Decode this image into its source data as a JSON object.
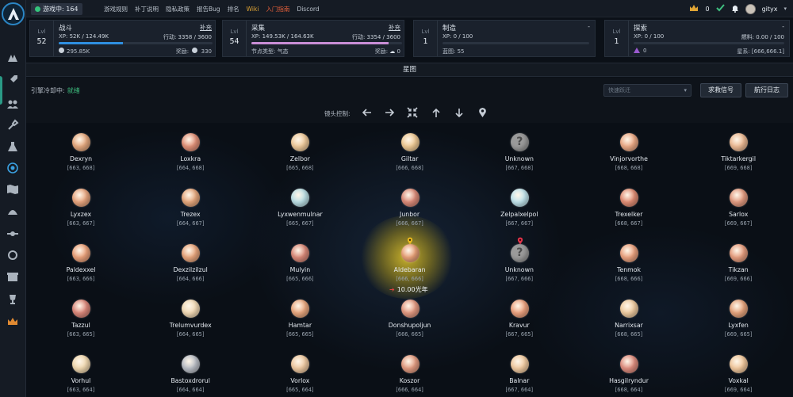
{
  "topbar": {
    "online_label": "游戏中: 164",
    "links": [
      "游戏规则",
      "补丁说明",
      "隐私政策",
      "报告Bug",
      "排名",
      "Wiki",
      "入门指南",
      "Discord"
    ],
    "crown_count": "0",
    "username": "gityx"
  },
  "stats": {
    "combat": {
      "lvl_label": "Lvl",
      "level": "52",
      "name": "战斗",
      "link": "补充",
      "xp": "XP: 52K / 124.49K",
      "action": "行动: 3358 / 3600",
      "progress": 0.42,
      "resource": "295.85K",
      "reward_label": "奖励:",
      "reward_value": "330",
      "bar_color": "#2f8fe0"
    },
    "gathering": {
      "lvl_label": "Lvl",
      "level": "54",
      "name": "采集",
      "link": "补充",
      "xp": "XP: 149.53K / 164.63K",
      "action": "行动: 3354 / 3600",
      "progress": 0.91,
      "node_type": "节点类型: 气态",
      "reward_label": "奖励:",
      "reward_value": "0",
      "bar_color": "#c98ed6"
    },
    "crafting": {
      "lvl_label": "Lvl",
      "level": "1",
      "name": "制造",
      "link": "-",
      "xp": "XP: 0 / 100",
      "blueprint": "蓝图: 55",
      "progress": 0
    },
    "exploring": {
      "lvl_label": "Lvl",
      "level": "1",
      "name": "探索",
      "link": "-",
      "xp": "XP: 0 / 100",
      "fuel": "燃料: 0.00 / 100",
      "crystal": "0",
      "star": "星系: [666,666.1]",
      "progress": 0
    }
  },
  "map": {
    "title": "星图",
    "cooldown_label": "引擎冷却中:",
    "cooldown_status": "就绪",
    "jump_placeholder": "快速跃迁",
    "sos_button": "求救信号",
    "log_button": "航行日志",
    "camera_label": "镜头控制:",
    "distance": "10.00光年"
  },
  "stars": [
    {
      "name": "Dexryn",
      "coord": "[663, 668]",
      "color": "#e2a77e"
    },
    {
      "name": "Loxkra",
      "coord": "[664, 668]",
      "color": "#de9078"
    },
    {
      "name": "Zelbor",
      "coord": "[665, 668]",
      "color": "#ecc89a"
    },
    {
      "name": "Giltar",
      "coord": "[666, 668]",
      "color": "#ecc894"
    },
    {
      "name": "Unknown",
      "coord": "[667, 668]",
      "color": "unknown"
    },
    {
      "name": "Vinjorvorthe",
      "coord": "[668, 668]",
      "color": "#e9a885"
    },
    {
      "name": "Tiktarkergil",
      "coord": "[669, 668]",
      "color": "#eab893"
    },
    {
      "name": "Lyxzex",
      "coord": "[663, 667]",
      "color": "#e6a47e"
    },
    {
      "name": "Trezex",
      "coord": "[664, 667]",
      "color": "#e3a67c"
    },
    {
      "name": "Lyxwenmulnar",
      "coord": "[665, 667]",
      "color": "#b9dde3"
    },
    {
      "name": "Junbor",
      "coord": "[666, 667]",
      "color": "#d98a78"
    },
    {
      "name": "Zelpalxelpol",
      "coord": "[667, 667]",
      "color": "#bfe2ea"
    },
    {
      "name": "Trexelker",
      "coord": "[668, 667]",
      "color": "#de8c74"
    },
    {
      "name": "Sarlox",
      "coord": "[669, 667]",
      "color": "#e09a80"
    },
    {
      "name": "Paldexxel",
      "coord": "[663, 666]",
      "color": "#e8a07a"
    },
    {
      "name": "Dexzilzilzul",
      "coord": "[664, 666]",
      "color": "#e6a47c"
    },
    {
      "name": "Mulyin",
      "coord": "[665, 666]",
      "color": "#d78878"
    },
    {
      "name": "Aldebaran",
      "coord": "[666, 666]",
      "color": "#e59e76"
    },
    {
      "name": "Unknown",
      "coord": "[667, 666]",
      "color": "unknown"
    },
    {
      "name": "Tenmok",
      "coord": "[668, 666]",
      "color": "#e8a07e"
    },
    {
      "name": "Tikzan",
      "coord": "[669, 666]",
      "color": "#e49c7e"
    },
    {
      "name": "Tazzul",
      "coord": "[663, 665]",
      "color": "#d9877a"
    },
    {
      "name": "Trelumvurdex",
      "coord": "[664, 665]",
      "color": "#f0d8b4"
    },
    {
      "name": "Hamtar",
      "coord": "[665, 665]",
      "color": "#e6a67e"
    },
    {
      "name": "Donshupoljun",
      "coord": "[666, 665]",
      "color": "#e09880"
    },
    {
      "name": "Kravur",
      "coord": "[667, 665]",
      "color": "#e9a07e"
    },
    {
      "name": "Narrixsar",
      "coord": "[668, 665]",
      "color": "#ecc99f"
    },
    {
      "name": "Lyxfen",
      "coord": "[669, 665]",
      "color": "#e3a27c"
    },
    {
      "name": "Vorhul",
      "coord": "[663, 664]",
      "color": "#eed6ae"
    },
    {
      "name": "Bastoxdrorul",
      "coord": "[664, 664]",
      "color": "#b8bcc4"
    },
    {
      "name": "Vorlox",
      "coord": "[665, 664]",
      "color": "#ecc7a0"
    },
    {
      "name": "Koszor",
      "coord": "[666, 664]",
      "color": "#e09a80"
    },
    {
      "name": "Balnar",
      "coord": "[667, 664]",
      "color": "#efc9a0"
    },
    {
      "name": "Hasgilryndur",
      "coord": "[668, 664]",
      "color": "#dc8c7e"
    },
    {
      "name": "Voxkal",
      "coord": "[669, 664]",
      "color": "#efc69c"
    }
  ]
}
